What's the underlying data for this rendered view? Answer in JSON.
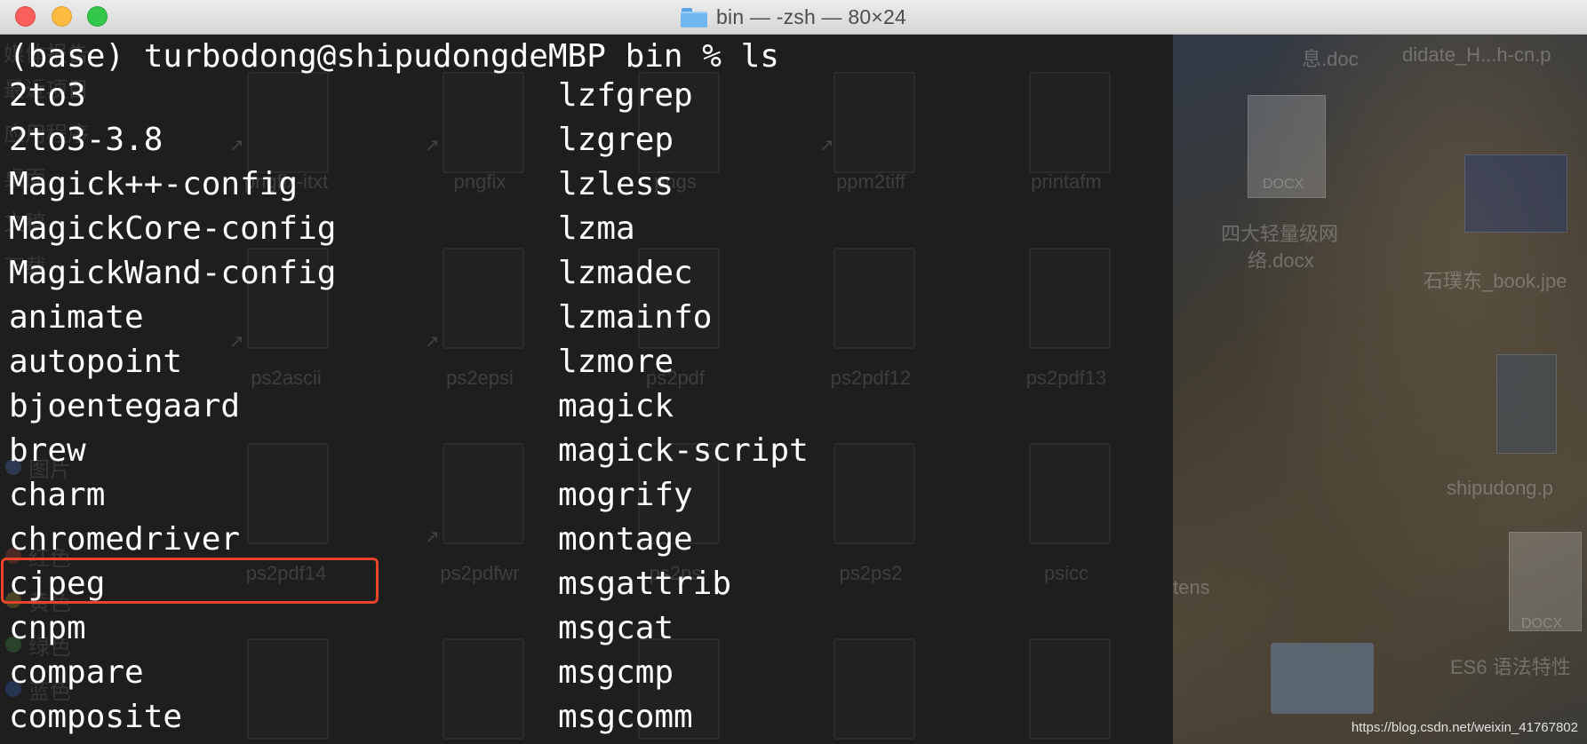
{
  "window": {
    "title": "bin — -zsh — 80×24"
  },
  "terminal": {
    "prompt": "(base) turbodong@shipudongdeMBP bin % ls",
    "left_column": [
      "2to3",
      "2to3-3.8",
      "Magick++-config",
      "MagickCore-config",
      "MagickWand-config",
      "animate",
      "autopoint",
      "bjoentegaard",
      "brew",
      "charm",
      "chromedriver",
      "cjpeg",
      "cnpm",
      "compare",
      "composite"
    ],
    "right_column": [
      "lzfgrep",
      "lzgrep",
      "lzless",
      "lzma",
      "lzmadec",
      "lzmainfo",
      "lzmore",
      "magick",
      "magick-script",
      "mogrify",
      "montage",
      "msgattrib",
      "msgcat",
      "msgcmp",
      "msgcomm"
    ],
    "highlighted_item": "chromedriver",
    "highlight_color": "#e8442b"
  },
  "background_finder": {
    "row1": [
      "pngfix-itxt",
      "pngfix",
      "pngs",
      "ppm2tiff",
      "printafm"
    ],
    "row2": [
      "ps2ascii",
      "ps2epsi",
      "ps2pdf",
      "ps2pdf12",
      "ps2pdf13"
    ],
    "row3": [
      "ps2pdf14",
      "ps2pdfwr",
      "ps2ps",
      "ps2ps2",
      "psicc"
    ],
    "sidebar": [
      "媒体报告",
      "最近项目",
      "应用程序",
      "桌面",
      "文稿",
      "下载",
      "图片",
      "红色",
      "黄色",
      "绿色",
      "蓝色"
    ]
  },
  "desktop": {
    "items": [
      "息.doc",
      "didate_H...h-cn.p",
      "DOCX",
      "四大轻量级网",
      "络.docx",
      "石璞东_book.jpe",
      "shipudong.p",
      "tens",
      "DOCX",
      "ES6 语法特性"
    ]
  },
  "watermark": "https://blog.csdn.net/weixin_41767802"
}
